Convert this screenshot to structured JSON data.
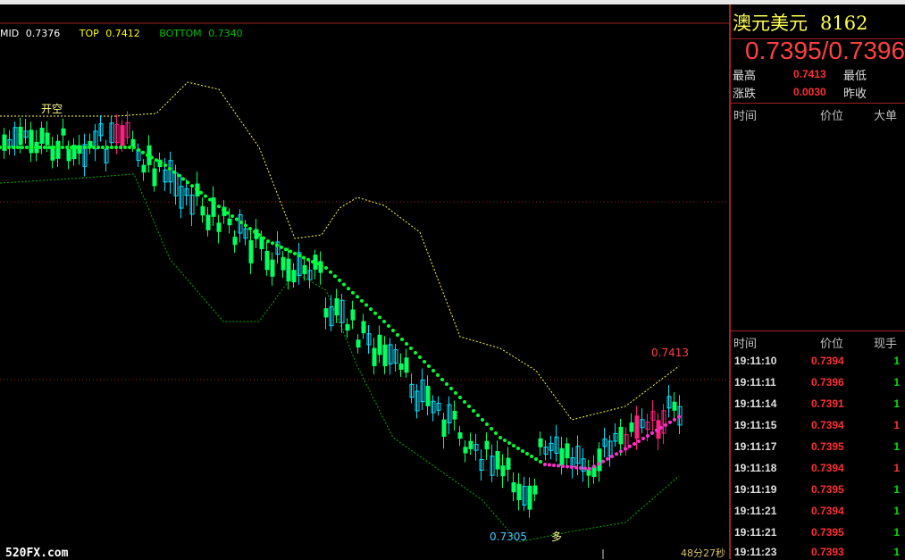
{
  "indicator": {
    "mid_label": "MID",
    "mid_value": "0.7376",
    "top_label": "TOP",
    "top_value": "0.7412",
    "bottom_label": "BOTTOM",
    "bottom_value": "0.7340"
  },
  "chart_data": {
    "type": "candlestick",
    "annotations": {
      "high_label": "0.7413",
      "low_label": "0.7305",
      "open_short_marker": "开空",
      "long_marker": "多"
    },
    "reference_lines": [
      0.7412,
      0.7376
    ]
  },
  "watermark": "520FX.com",
  "timer": "48分27秒",
  "panel": {
    "name": "澳元美元",
    "code": "8162",
    "price": "0.7395/0.7396",
    "high_label": "最高",
    "high_value": "0.7413",
    "low_label": "最低",
    "change_label": "涨跌",
    "change_value": "0.0030",
    "prev_label": "昨收",
    "trades_header": {
      "time": "时间",
      "price": "价位",
      "big": "大单"
    },
    "ticks_header": {
      "time": "时间",
      "price": "价位",
      "volume": "现手"
    },
    "ticks": [
      {
        "time": "19:11:10",
        "price": "0.7394",
        "volume": "1",
        "color": "#00e000"
      },
      {
        "time": "19:11:11",
        "price": "0.7396",
        "volume": "1",
        "color": "#00e000"
      },
      {
        "time": "19:11:14",
        "price": "0.7391",
        "volume": "1",
        "color": "#00e000"
      },
      {
        "time": "19:11:15",
        "price": "0.7394",
        "volume": "1",
        "color": "#ff3030"
      },
      {
        "time": "19:11:17",
        "price": "0.7395",
        "volume": "1",
        "color": "#00e000"
      },
      {
        "time": "19:11:18",
        "price": "0.7394",
        "volume": "1",
        "color": "#ff3030"
      },
      {
        "time": "19:11:19",
        "price": "0.7395",
        "volume": "1",
        "color": "#00e000"
      },
      {
        "time": "19:11:21",
        "price": "0.7394",
        "volume": "1",
        "color": "#00e000"
      },
      {
        "time": "19:11:21",
        "price": "0.7395",
        "volume": "1",
        "color": "#00e000"
      },
      {
        "time": "19:11:23",
        "price": "0.7393",
        "volume": "1",
        "color": "#00e000"
      }
    ]
  }
}
